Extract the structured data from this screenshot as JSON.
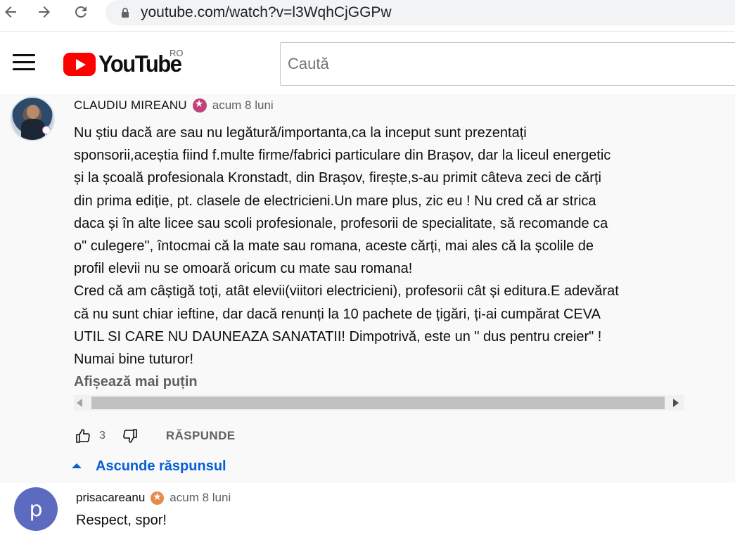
{
  "browser": {
    "url_host": "youtube.com",
    "url_path": "/watch?v=l3WqhCjGGPw"
  },
  "header": {
    "logo_text": "YouTube",
    "region": "RO",
    "search_placeholder": "Caută"
  },
  "comment": {
    "author": "CLAUDIU MIREANU",
    "timestamp": "acum 8 luni",
    "text": "Nu știu dacă are sau nu legătură/importanta,ca la inceput sunt prezentați\nsponsorii,aceștia fiind f.multe firme/fabrici particulare din Brașov, dar la liceul energetic\nși la școală profesionala Kronstadt, din Brașov, firește,s-au primit câteva zeci de cărți\ndin prima ediție, pt. clasele de electricieni.Un mare plus, zic eu ! Nu cred că ar strica\ndaca și în alte licee sau scoli profesionale, profesorii de specialitate, să recomande ca\no\" culegere\", întocmai că la mate sau romana, aceste cărți, mai ales că la școlile de\nprofil elevii nu se omoară oricum cu mate sau romana!\nCred că am câștigă toți, atât elevii(viitori electricieni), profesorii cât și editura.E adevărat\ncă nu sunt chiar ieftine, dar dacă renunți la 10 pachete de țigări, ți-ai cumpărat CEVA\nUTIL SI CARE NU DAUNEAZA SANATATII! Dimpotrivă, este un \" dus pentru creier\" !\nNumai bine tuturor!",
    "show_less_label": "Afișează mai puțin",
    "like_count": "3",
    "reply_label": "RĂSPUNDE",
    "hide_replies_label": "Ascunde răspunsul"
  },
  "reply": {
    "avatar_letter": "p",
    "author": "prisacareanu",
    "timestamp": "acum 8 luni",
    "text": "Respect, spor!"
  },
  "colors": {
    "brand_red": "#ff0000",
    "link_blue": "#065fd4",
    "reply_avatar": "#5c6bc0"
  }
}
